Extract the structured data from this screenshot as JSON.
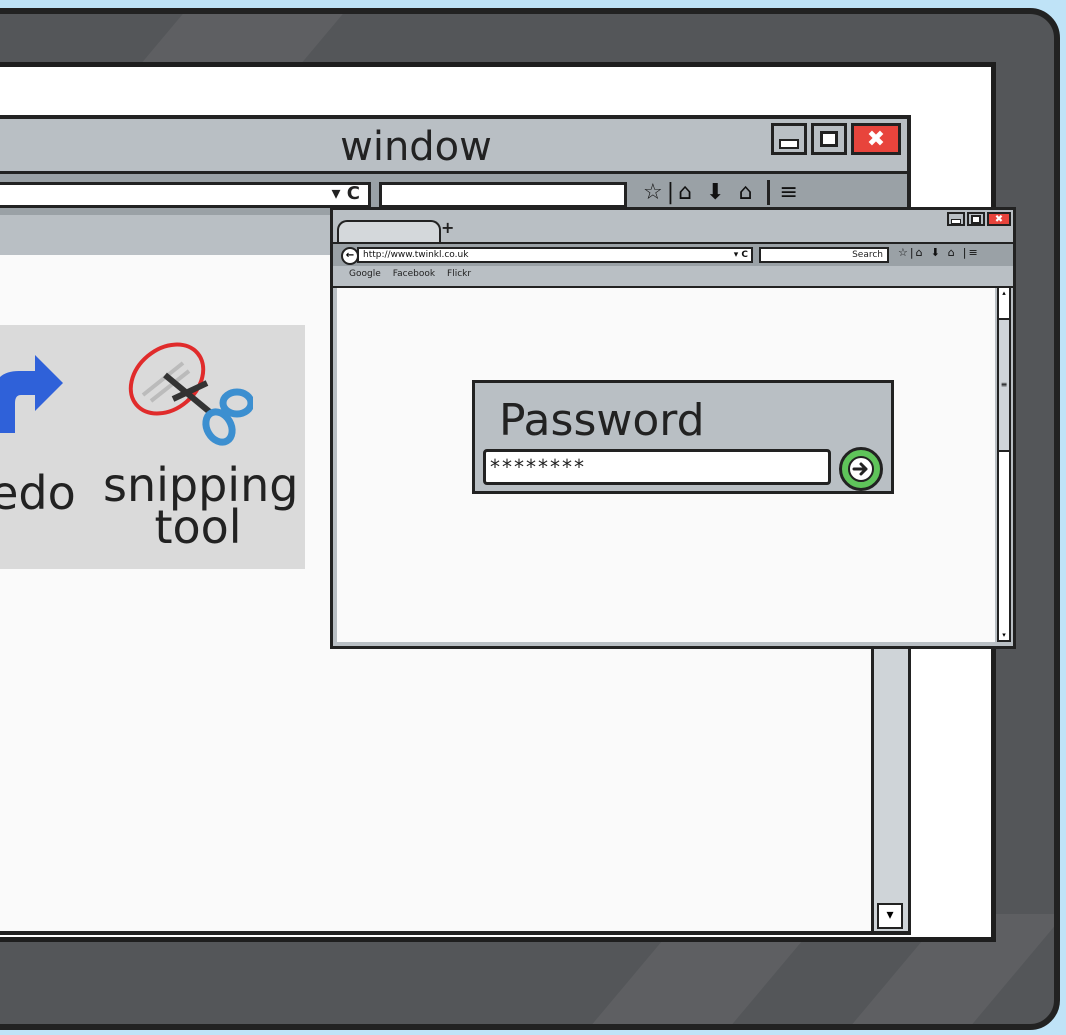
{
  "colors": {
    "sky": "#bfe3f7",
    "bezel": "#545659",
    "window_grey": "#b9bfc4",
    "close_red": "#e8443c",
    "go_green": "#5fc45a",
    "redo_blue": "#2f61d9",
    "highlight_red": "#e02b2b"
  },
  "main_window": {
    "title": "window",
    "controls": [
      "minimize-icon",
      "maximize-icon",
      "close-icon"
    ],
    "close_glyph": "✖",
    "refresh_glyph": "▾ C",
    "toolbar_icons": [
      "☆",
      "|",
      "⌂",
      "⬇",
      "⌂",
      "≡"
    ],
    "content": {
      "redo_label": "redo",
      "snip_label_1": "snipping",
      "snip_label_2": "tool"
    },
    "scroll_down": "▾"
  },
  "popup_window": {
    "new_tab": "+",
    "back_glyph": "←",
    "url": "http://www.twinkl.co.uk",
    "refresh_glyph": "▾ C",
    "search_placeholder": "Search",
    "toolbar_icons": [
      "☆",
      "|",
      "⌂",
      "⬇",
      "⌂",
      "|",
      "≡"
    ],
    "bookmarks": [
      "Google",
      "Facebook",
      "Flickr"
    ],
    "scroll_up": "▴",
    "scroll_mid": "≡",
    "scroll_down": "▾",
    "password": {
      "title": "Password",
      "value": "********"
    }
  }
}
